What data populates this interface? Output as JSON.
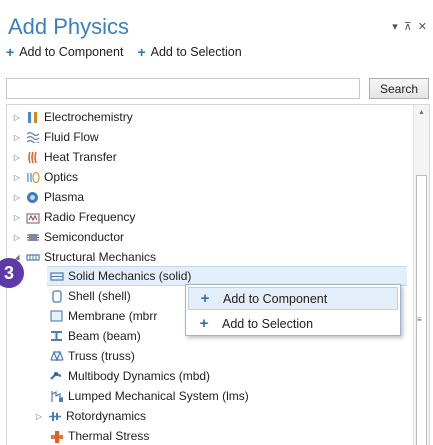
{
  "window": {
    "title": "Add Physics",
    "controls": [
      "▾",
      "⊼",
      "✕"
    ]
  },
  "toolbar": {
    "add_to_component": "Add to Component",
    "add_to_selection": "Add to Selection"
  },
  "search": {
    "value": "",
    "button": "Search"
  },
  "tree": {
    "items": [
      {
        "label": "Electrochemistry",
        "icon": "electrochemistry-icon",
        "expander": "▷"
      },
      {
        "label": "Fluid Flow",
        "icon": "fluid-flow-icon",
        "expander": "▷"
      },
      {
        "label": "Heat Transfer",
        "icon": "heat-transfer-icon",
        "expander": "▷"
      },
      {
        "label": "Optics",
        "icon": "optics-icon",
        "expander": "▷"
      },
      {
        "label": "Plasma",
        "icon": "plasma-icon",
        "expander": "▷"
      },
      {
        "label": "Radio Frequency",
        "icon": "radio-frequency-icon",
        "expander": "▷"
      },
      {
        "label": "Semiconductor",
        "icon": "semiconductor-icon",
        "expander": "▷"
      },
      {
        "label": "Structural Mechanics",
        "icon": "structural-mechanics-icon",
        "expander": "◢"
      },
      {
        "label": "Solid Mechanics (solid)",
        "icon": "solid-mechanics-icon",
        "selected": true
      },
      {
        "label": "Shell (shell)",
        "icon": "shell-icon"
      },
      {
        "label": "Membrane (mbrr",
        "icon": "membrane-icon"
      },
      {
        "label": "Beam (beam)",
        "icon": "beam-icon"
      },
      {
        "label": "Truss (truss)",
        "icon": "truss-icon"
      },
      {
        "label": "Multibody Dynamics (mbd)",
        "icon": "multibody-icon"
      },
      {
        "label": "Lumped Mechanical System (lms)",
        "icon": "lumped-mechanical-icon"
      },
      {
        "label": "Rotordynamics",
        "icon": "rotordynamics-icon",
        "expander": "▷"
      },
      {
        "label": "Thermal Stress",
        "icon": "thermal-stress-icon"
      }
    ]
  },
  "step_badge": "3",
  "context_menu": {
    "add_to_component": "Add to Component",
    "add_to_selection": "Add to Selection"
  },
  "colors": {
    "title": "#3a7fc2",
    "accent": "#2b6fb7",
    "badge": "#5d3aa8",
    "selection": "#e3eef9"
  }
}
